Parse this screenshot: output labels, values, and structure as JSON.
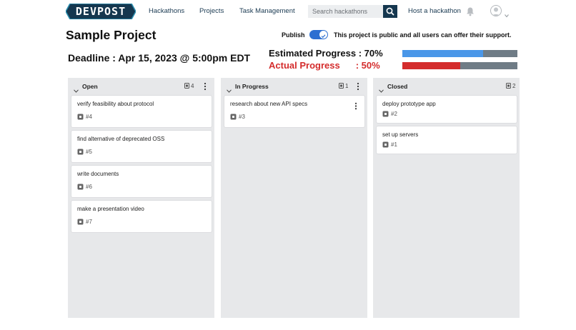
{
  "header": {
    "logo_text": "DEVPOST",
    "nav": [
      "Hackathons",
      "Projects",
      "Task Management"
    ],
    "search_placeholder": "Search hackathons",
    "host_link": "Host a hackathon"
  },
  "project": {
    "title": "Sample Project",
    "publish_label": "Publish",
    "publish_on": true,
    "public_note": "This project is public and all users can offer their support.",
    "deadline": "Deadline : Apr 15, 2023 @ 5:00pm EDT",
    "estimated": {
      "label": "Estimated Progress : ",
      "value_text": "70%",
      "percent": 70,
      "color": "#4a97e8"
    },
    "actual": {
      "label": "Actual Progress",
      "value_text": ": 50%",
      "percent": 50,
      "color": "#d42c2c"
    }
  },
  "columns": [
    {
      "title": "Open",
      "count": "4",
      "cards": [
        {
          "title": "verify feasibility about protocol",
          "issue": "#4"
        },
        {
          "title": "find alternative of deprecated OSS",
          "issue": "#5"
        },
        {
          "title": "write documents",
          "issue": "#6"
        },
        {
          "title": "make a presentation video",
          "issue": "#7"
        }
      ]
    },
    {
      "title": "In Progress",
      "count": "1",
      "cards": [
        {
          "title": "research about new API specs",
          "issue": "#3"
        }
      ]
    },
    {
      "title": "Closed",
      "count": "2",
      "cards": [
        {
          "title": "deploy prototype app",
          "issue": "#2"
        },
        {
          "title": "set up servers",
          "issue": "#1"
        }
      ]
    }
  ],
  "colors": {
    "brand": "#15374f",
    "toggle": "#2c6fd1",
    "column_bg": "#e7e8ea",
    "bar_track": "#6f7c86"
  }
}
